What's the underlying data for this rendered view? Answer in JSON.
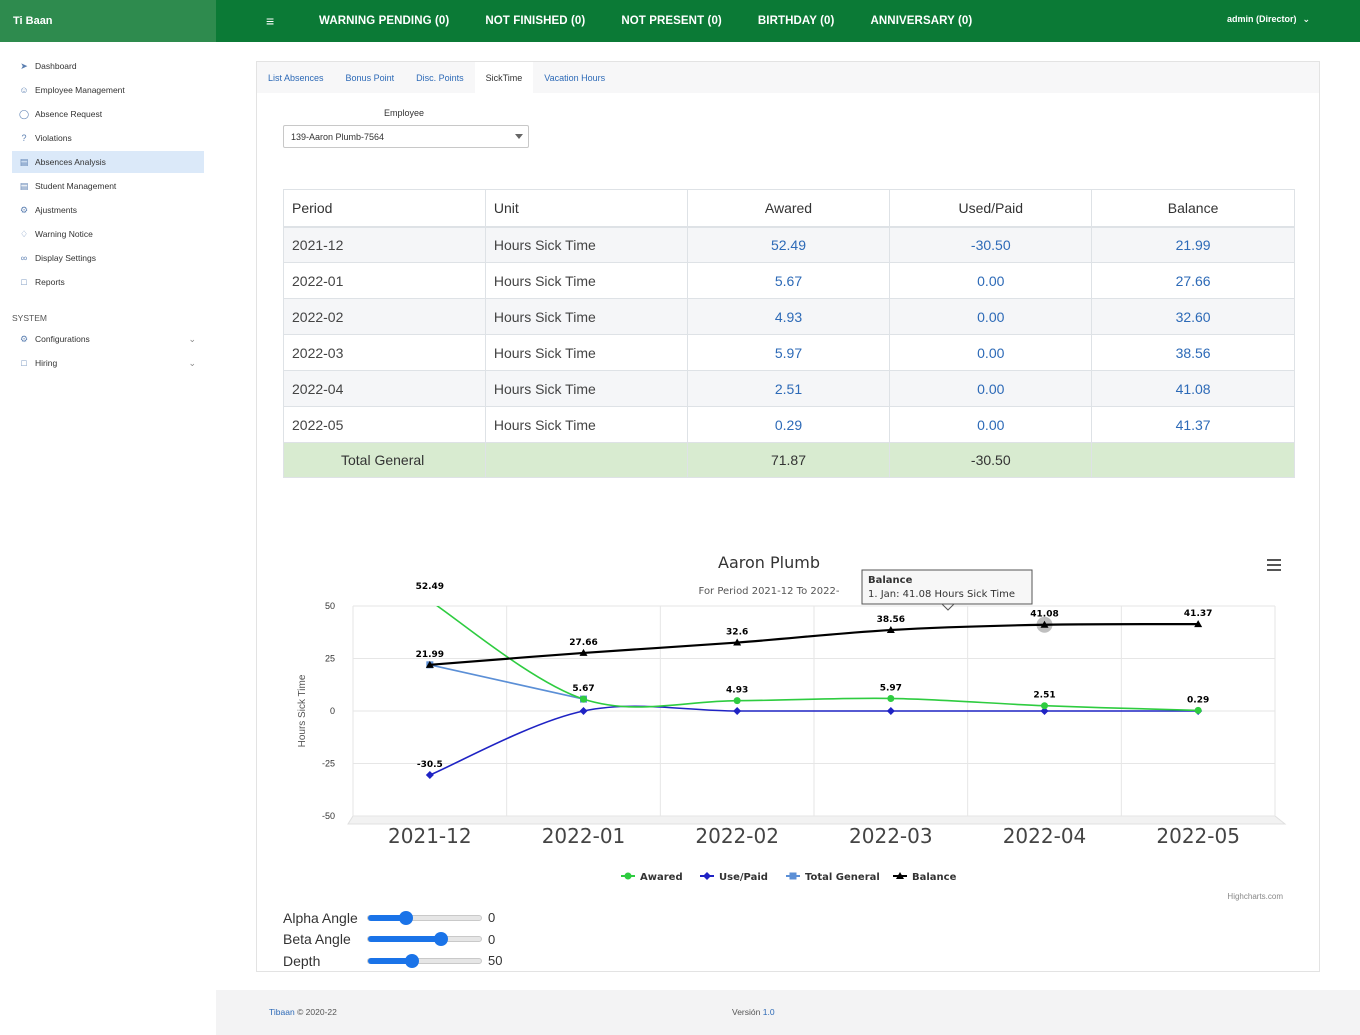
{
  "brand": "Ti Baan",
  "topnav": [
    "WARNING PENDING (0)",
    "NOT FINISHED (0)",
    "NOT PRESENT (0)",
    "BIRTHDAY (0)",
    "ANNIVERSARY (0)"
  ],
  "user": "admin (Director)",
  "sidebar": {
    "items": [
      {
        "label": "Dashboard",
        "icon": "send-icon"
      },
      {
        "label": "Employee Management",
        "icon": "users-icon"
      },
      {
        "label": "Absence Request",
        "icon": "clock-icon"
      },
      {
        "label": "Violations",
        "icon": "help-circle-icon"
      },
      {
        "label": "Absences Analysis",
        "icon": "bar-chart-icon"
      },
      {
        "label": "Student Management",
        "icon": "bar-chart-icon"
      },
      {
        "label": "Ajustments",
        "icon": "settings-icon"
      },
      {
        "label": "Warning Notice",
        "icon": "bell-icon"
      },
      {
        "label": "Display Settings",
        "icon": "link-icon"
      },
      {
        "label": "Reports",
        "icon": "file-icon"
      }
    ],
    "section": "SYSTEM",
    "system_items": [
      {
        "label": "Configurations",
        "icon": "settings-icon"
      },
      {
        "label": "Hiring",
        "icon": "file-icon"
      }
    ]
  },
  "tabs": [
    "List Absences",
    "Bonus Point",
    "Disc. Points",
    "SickTime",
    "Vacation Hours"
  ],
  "active_tab": "SickTime",
  "employee": {
    "label": "Employee",
    "value": "139-Aaron Plumb-7564"
  },
  "table": {
    "headers": [
      "Period",
      "Unit",
      "Awared",
      "Used/Paid",
      "Balance"
    ],
    "rows": [
      [
        "2021-12",
        "Hours Sick Time",
        "52.49",
        "-30.50",
        "21.99"
      ],
      [
        "2022-01",
        "Hours Sick Time",
        "5.67",
        "0.00",
        "27.66"
      ],
      [
        "2022-02",
        "Hours Sick Time",
        "4.93",
        "0.00",
        "32.60"
      ],
      [
        "2022-03",
        "Hours Sick Time",
        "5.97",
        "0.00",
        "38.56"
      ],
      [
        "2022-04",
        "Hours Sick Time",
        "2.51",
        "0.00",
        "41.08"
      ],
      [
        "2022-05",
        "Hours Sick Time",
        "0.29",
        "0.00",
        "41.37"
      ]
    ],
    "total": [
      "Total General",
      "",
      "71.87",
      "-30.50",
      ""
    ]
  },
  "chart_data": {
    "type": "line",
    "title": "Aaron Plumb",
    "subtitle": "For Period 2021-12 To 2022-",
    "ylabel": "Hours Sick Time",
    "ylim": [
      -50,
      50
    ],
    "yticks": [
      50,
      25,
      0,
      -25,
      -50
    ],
    "categories": [
      "2021-12",
      "2022-01",
      "2022-02",
      "2022-03",
      "2022-04",
      "2022-05"
    ],
    "series": [
      {
        "name": "Awared",
        "color": "#2ecc40",
        "marker": "circle",
        "values": [
          52.49,
          5.67,
          4.93,
          5.97,
          2.51,
          0.29
        ]
      },
      {
        "name": "Use/Paid",
        "color": "#1f23c4",
        "marker": "diamond",
        "values": [
          -30.5,
          0,
          0,
          0,
          0,
          0
        ]
      },
      {
        "name": "Total General",
        "color": "#5b8fd6",
        "marker": "square",
        "values": [
          21.99,
          5.67,
          null,
          null,
          null,
          null
        ]
      },
      {
        "name": "Balance",
        "color": "#000000",
        "marker": "triangle",
        "values": [
          21.99,
          27.66,
          32.6,
          38.56,
          41.08,
          41.37
        ]
      }
    ],
    "value_labels": {
      "Awared": [
        "52.49",
        "5.67",
        "4.93",
        "5.97",
        "2.51",
        "0.29"
      ],
      "Use/Paid": [
        "-30.5",
        "",
        "",
        "",
        "",
        ""
      ],
      "Balance": [
        "21.99",
        "27.66",
        "32.6",
        "38.56",
        "41.08",
        "41.37"
      ]
    },
    "tooltip": {
      "title": "Balance",
      "text": "1. Jan: 41.08 Hours Sick Time"
    },
    "credits": "Highcharts.com",
    "legend": "bottom-center"
  },
  "sliders": [
    {
      "label": "Alpha Angle",
      "value": "0",
      "fraction": 0.34
    },
    {
      "label": "Beta Angle",
      "value": "0",
      "fraction": 0.65
    },
    {
      "label": "Depth",
      "value": "50",
      "fraction": 0.39
    }
  ],
  "footer": {
    "brand": "Tibaan",
    "copyright": "© 2020-22",
    "version_label": "Versión",
    "version": "1.0"
  }
}
